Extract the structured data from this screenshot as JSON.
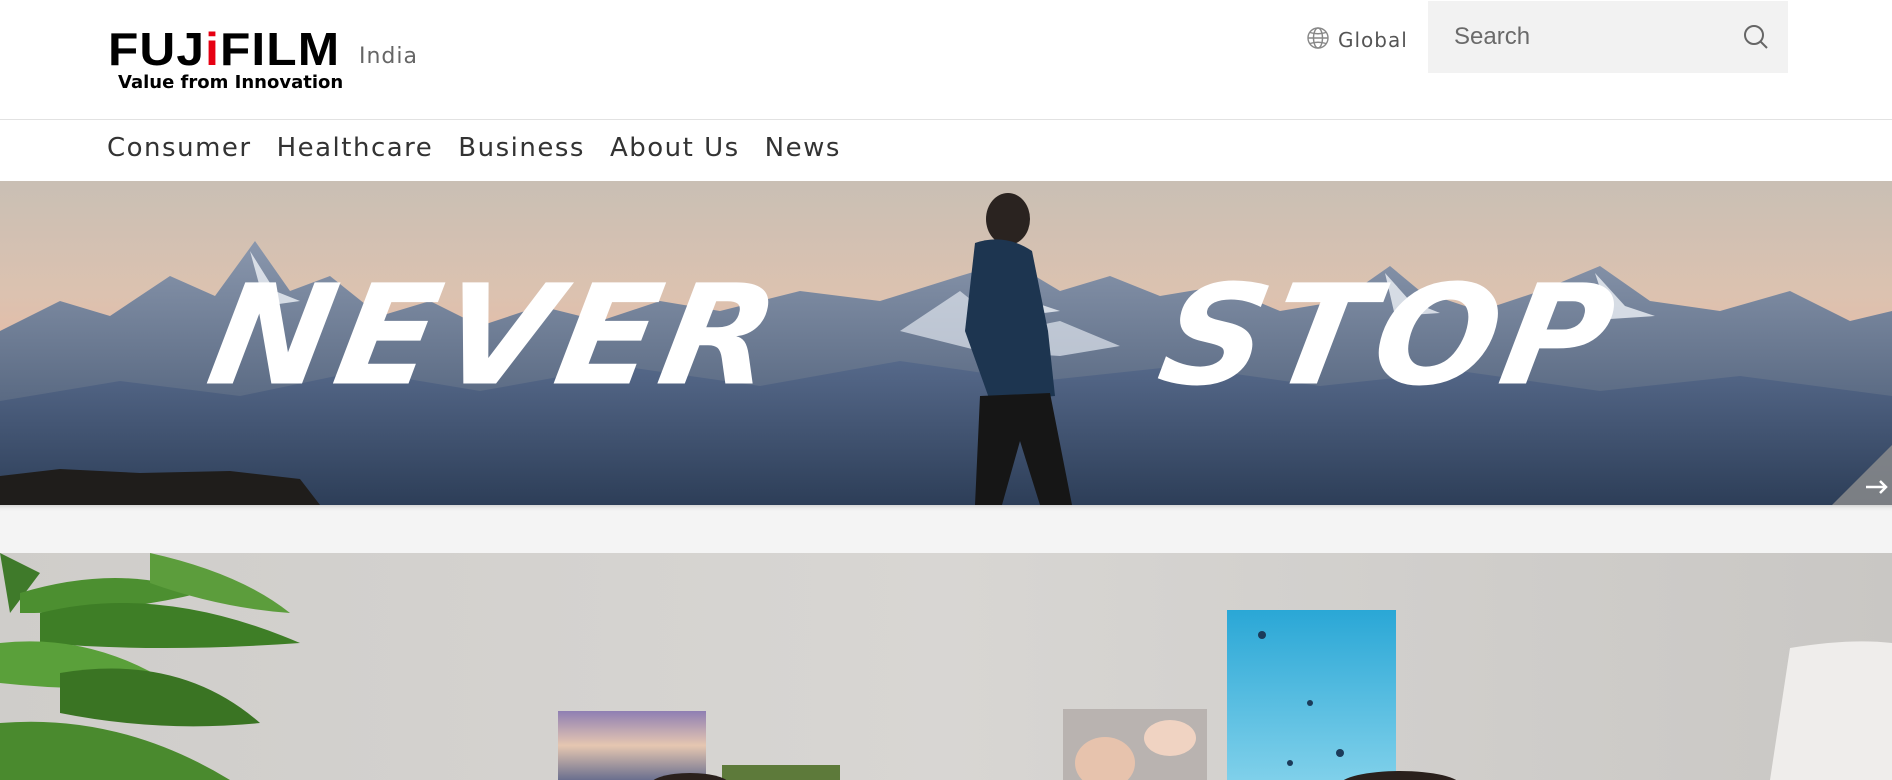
{
  "brand": {
    "logo_text_left": "FUJ",
    "logo_text_dot": "i",
    "logo_text_right": "FILM",
    "tagline": "Value from Innovation",
    "region": "India",
    "accent_color": "#e60012"
  },
  "header": {
    "global_label": "Global",
    "global_icon": "globe-icon",
    "search_placeholder": "Search",
    "search_value": "",
    "search_icon": "search-icon"
  },
  "nav": {
    "items": [
      {
        "label": "Consumer"
      },
      {
        "label": "Healthcare"
      },
      {
        "label": "Business"
      },
      {
        "label": "About Us"
      },
      {
        "label": "News"
      }
    ]
  },
  "hero": {
    "word_1": "NEVER",
    "word_2": "STOP",
    "next_icon": "arrow-right-icon"
  }
}
